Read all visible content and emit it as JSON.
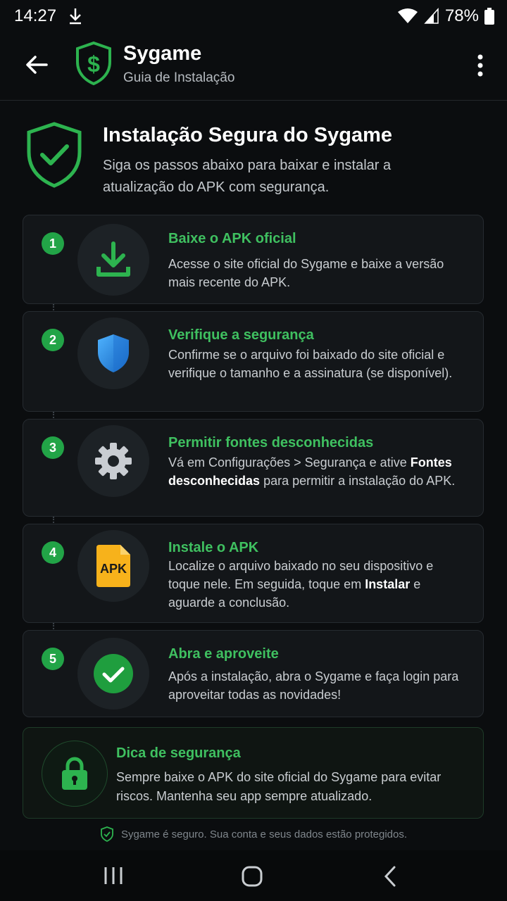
{
  "status_bar": {
    "time": "14:27",
    "battery": "78%"
  },
  "app_bar": {
    "title": "Sygame",
    "subtitle": "Guia de Instalação"
  },
  "hero": {
    "title": "Instalação Segura do Sygame",
    "description": "Siga os passos abaixo para baixar e instalar a atualização do APK com segurança."
  },
  "steps": [
    {
      "number": "1",
      "title": "Baixe o APK oficial",
      "icon": "download-icon",
      "desc": "Acesse o site oficial do Sygame e baixe a versão mais recente do APK."
    },
    {
      "number": "2",
      "title": "Verifique a segurança",
      "icon": "shield-icon",
      "desc": "Confirme se o arquivo foi baixado do site oficial e verifique o tamanho e a assinatura (se disponível)."
    },
    {
      "number": "3",
      "title": "Permitir fontes desconhecidas",
      "icon": "gear-icon",
      "desc_pre": "Vá em Configurações > Segurança e ative ",
      "desc_bold": "Fontes desconhecidas",
      "desc_post": " para permitir a instalação do APK."
    },
    {
      "number": "4",
      "title": "Instale o APK",
      "icon": "apk-file-icon",
      "icon_label": "APK",
      "desc_pre": "Localize o arquivo baixado no seu dispositivo e toque nele. Em seguida, toque em ",
      "desc_bold": "Instalar",
      "desc_post": " e aguarde a conclusão."
    },
    {
      "number": "5",
      "title": "Abra e aproveite",
      "icon": "check-circle-icon",
      "desc": "Após a instalação, abra o Sygame e faça login para aproveitar todas as novidades!"
    }
  ],
  "tip": {
    "title": "Dica de segurança",
    "desc": "Sempre baixe o APK do site oficial do Sygame para evitar riscos. Mantenha seu app sempre atualizado."
  },
  "footer_note": "Sygame é seguro. Sua conta e seus dados estão protegidos.",
  "colors": {
    "accent": "#3fc060",
    "badge": "#22a447",
    "background": "#0b0d0f",
    "card": "#131619"
  }
}
